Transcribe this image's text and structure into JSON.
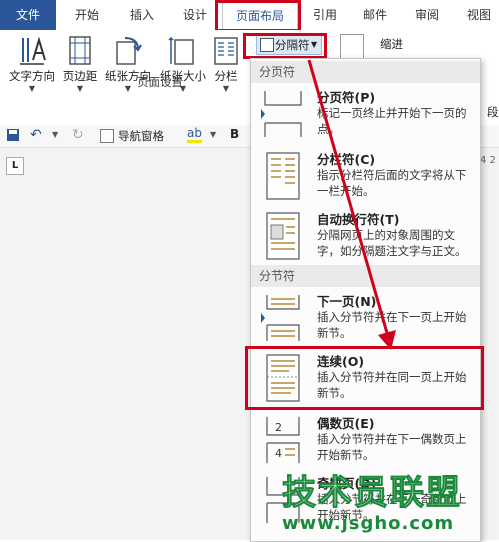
{
  "ribbon_tabs": [
    {
      "label": "文件"
    },
    {
      "label": "开始"
    },
    {
      "label": "插入"
    },
    {
      "label": "设计"
    },
    {
      "label": "页面布局"
    },
    {
      "label": "引用"
    },
    {
      "label": "邮件"
    },
    {
      "label": "审阅"
    },
    {
      "label": "视图"
    }
  ],
  "ribbon_buttons": {
    "text_direction": "文字方向",
    "margins": "页边距",
    "orientation": "纸张方向",
    "size": "纸张大小",
    "columns": "分栏",
    "breaks": "分隔符",
    "indent": "缩进",
    "paragraph": "段"
  },
  "group_label": "页面设置",
  "qat": {
    "nav_pane": "导航窗格",
    "bold": "B"
  },
  "doc": {
    "l_marker": "L",
    "ruler_nums": "4  2"
  },
  "menu": {
    "section_page": "分页符",
    "section_section": "分节符",
    "items": [
      {
        "title": "分页符(P)",
        "desc": "标记一页终止并开始下一页的点。"
      },
      {
        "title": "分栏符(C)",
        "desc": "指示分栏符后面的文字将从下一栏开始。"
      },
      {
        "title": "自动换行符(T)",
        "desc": "分隔网页上的对象周围的文字，如分隔题注文字与正文。"
      },
      {
        "title": "下一页(N)",
        "desc": "插入分节符并在下一页上开始新节。"
      },
      {
        "title": "连续(O)",
        "desc": "插入分节符并在同一页上开始新节。"
      },
      {
        "title": "偶数页(E)",
        "desc": "插入分节符并在下一偶数页上开始新节。"
      },
      {
        "title": "奇数页(D)",
        "desc": "插入分节符并在下一奇数页上开始新节。"
      }
    ]
  },
  "icon_digits": {
    "even_a": "2",
    "even_b": "4"
  },
  "watermark": {
    "title": "技术员联盟",
    "url": "www.jsgho.com"
  },
  "colors": {
    "highlight": "#d0021b",
    "file_tab": "#2b579a"
  }
}
